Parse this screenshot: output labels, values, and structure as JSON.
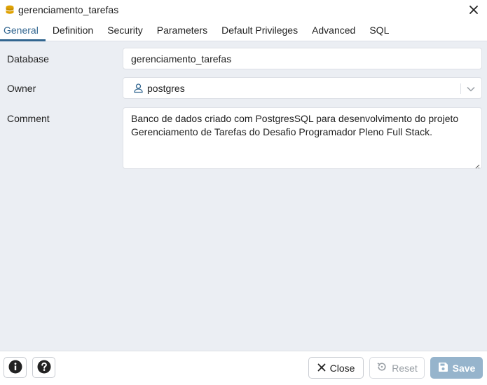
{
  "window": {
    "title": "gerenciamento_tarefas"
  },
  "tabs": [
    {
      "label": "General",
      "active": true
    },
    {
      "label": "Definition"
    },
    {
      "label": "Security"
    },
    {
      "label": "Parameters"
    },
    {
      "label": "Default Privileges"
    },
    {
      "label": "Advanced"
    },
    {
      "label": "SQL"
    }
  ],
  "form": {
    "database_label": "Database",
    "database_value": "gerenciamento_tarefas",
    "owner_label": "Owner",
    "owner_value": "postgres",
    "comment_label": "Comment",
    "comment_value": "Banco de dados criado com PostgresSQL para desenvolvimento do projeto Gerenciamento de Tarefas do Desafio Programador Pleno Full Stack."
  },
  "footer": {
    "close_label": "Close",
    "reset_label": "Reset",
    "save_label": "Save"
  },
  "colors": {
    "accent": "#326690",
    "background": "#ebeef3",
    "save_disabled": "#96b4cc"
  },
  "icons": {
    "title": "database-icon",
    "owner": "user-icon",
    "info": "info-icon",
    "help": "help-icon",
    "close": "close-icon",
    "reset": "reset-icon",
    "save": "save-icon"
  }
}
